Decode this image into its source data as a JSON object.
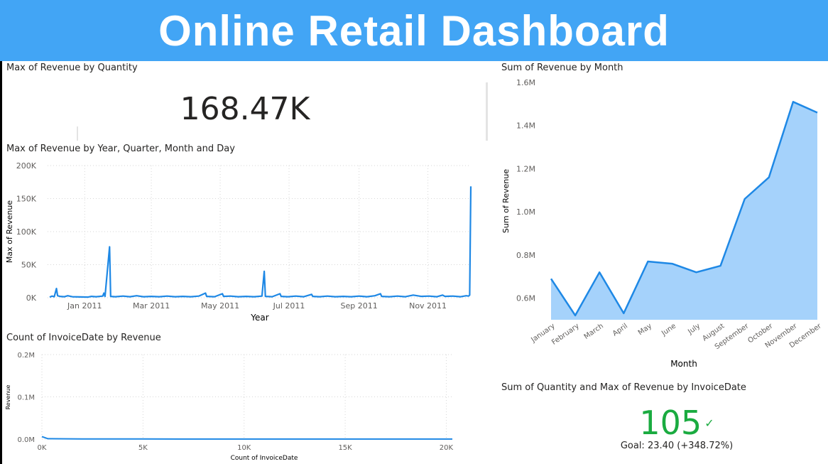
{
  "header": {
    "title": "Online Retail Dashboard"
  },
  "card": {
    "title": "Max of Revenue by Quantity",
    "value": "168.47K"
  },
  "kpi": {
    "title": "Sum of Quantity and Max of Revenue by InvoiceDate",
    "value": "105",
    "goal": "Goal: 23.40 (+348.72%)"
  },
  "chart_data": [
    {
      "type": "line",
      "title": "Max of Revenue by Year, Quarter, Month and Day",
      "xlabel": "Year",
      "ylabel": "Max of Revenue",
      "y_ticks": [
        "0K",
        "50K",
        "100K",
        "150K",
        "200K"
      ],
      "ylim": [
        0,
        200000
      ],
      "x_ticks": [
        "Jan 2011",
        "Mar 2011",
        "May 2011",
        "Jul 2011",
        "Sep 2011",
        "Nov 2011"
      ],
      "x_tick_dates": [
        "2011-01-01",
        "2011-03-01",
        "2011-05-01",
        "2011-07-01",
        "2011-09-01",
        "2011-11-01"
      ],
      "x_range": [
        "2010-12-01",
        "2011-12-09"
      ],
      "series": [
        {
          "points": [
            [
              "2010-12-01",
              1000
            ],
            [
              "2010-12-03",
              2500
            ],
            [
              "2010-12-05",
              1500
            ],
            [
              "2010-12-07",
              14000
            ],
            [
              "2010-12-08",
              3000
            ],
            [
              "2010-12-10",
              2000
            ],
            [
              "2010-12-14",
              1500
            ],
            [
              "2010-12-17",
              3000
            ],
            [
              "2010-12-21",
              1500
            ],
            [
              "2011-01-04",
              1000
            ],
            [
              "2011-01-07",
              2000
            ],
            [
              "2011-01-11",
              1500
            ],
            [
              "2011-01-17",
              2500
            ],
            [
              "2011-01-18",
              7000
            ],
            [
              "2011-01-19",
              2000
            ],
            [
              "2011-01-23",
              77000
            ],
            [
              "2011-01-24",
              2000
            ],
            [
              "2011-01-28",
              1500
            ],
            [
              "2011-02-04",
              2500
            ],
            [
              "2011-02-10",
              1500
            ],
            [
              "2011-02-16",
              3000
            ],
            [
              "2011-02-22",
              1500
            ],
            [
              "2011-03-01",
              2000
            ],
            [
              "2011-03-08",
              1500
            ],
            [
              "2011-03-15",
              2500
            ],
            [
              "2011-03-22",
              1500
            ],
            [
              "2011-03-29",
              2000
            ],
            [
              "2011-04-05",
              1500
            ],
            [
              "2011-04-12",
              2500
            ],
            [
              "2011-04-18",
              7000
            ],
            [
              "2011-04-19",
              2000
            ],
            [
              "2011-04-26",
              1500
            ],
            [
              "2011-05-03",
              6000
            ],
            [
              "2011-05-04",
              2000
            ],
            [
              "2011-05-10",
              2500
            ],
            [
              "2011-05-17",
              1500
            ],
            [
              "2011-05-24",
              2000
            ],
            [
              "2011-05-31",
              1500
            ],
            [
              "2011-06-07",
              2500
            ],
            [
              "2011-06-09",
              40000
            ],
            [
              "2011-06-10",
              2000
            ],
            [
              "2011-06-16",
              1500
            ],
            [
              "2011-06-23",
              6000
            ],
            [
              "2011-06-24",
              2000
            ],
            [
              "2011-06-30",
              1500
            ],
            [
              "2011-07-07",
              2500
            ],
            [
              "2011-07-14",
              1500
            ],
            [
              "2011-07-21",
              5000
            ],
            [
              "2011-07-22",
              2000
            ],
            [
              "2011-07-28",
              1500
            ],
            [
              "2011-08-04",
              2500
            ],
            [
              "2011-08-11",
              1500
            ],
            [
              "2011-08-18",
              2000
            ],
            [
              "2011-08-25",
              1500
            ],
            [
              "2011-09-01",
              2500
            ],
            [
              "2011-09-08",
              1500
            ],
            [
              "2011-09-15",
              3000
            ],
            [
              "2011-09-20",
              6000
            ],
            [
              "2011-09-21",
              2000
            ],
            [
              "2011-09-28",
              1500
            ],
            [
              "2011-10-05",
              2500
            ],
            [
              "2011-10-12",
              1500
            ],
            [
              "2011-10-19",
              4000
            ],
            [
              "2011-10-26",
              2000
            ],
            [
              "2011-11-02",
              2500
            ],
            [
              "2011-11-09",
              1500
            ],
            [
              "2011-11-14",
              4000
            ],
            [
              "2011-11-16",
              2000
            ],
            [
              "2011-11-23",
              2500
            ],
            [
              "2011-11-30",
              1500
            ],
            [
              "2011-12-05",
              3000
            ],
            [
              "2011-12-07",
              2500
            ],
            [
              "2011-12-08",
              4000
            ],
            [
              "2011-12-09",
              168470
            ]
          ]
        }
      ]
    },
    {
      "type": "area",
      "title": "Sum of Revenue by Month",
      "xlabel": "Month",
      "ylabel": "Sum of Revenue",
      "y_ticks": [
        "0.6M",
        "0.8M",
        "1.0M",
        "1.2M",
        "1.4M",
        "1.6M"
      ],
      "y_tick_values": [
        0.6,
        0.8,
        1.0,
        1.2,
        1.4,
        1.6
      ],
      "ylim": [
        0.5,
        1.6
      ],
      "categories": [
        "January",
        "February",
        "March",
        "April",
        "May",
        "June",
        "July",
        "August",
        "September",
        "October",
        "November",
        "December"
      ],
      "values": [
        0.69,
        0.52,
        0.72,
        0.53,
        0.77,
        0.76,
        0.72,
        0.75,
        1.06,
        1.16,
        1.51,
        1.46
      ]
    },
    {
      "type": "line",
      "title": "Count of InvoiceDate by Revenue",
      "xlabel": "Count of InvoiceDate",
      "ylabel": "Revenue",
      "y_ticks": [
        "0.0M",
        "0.1M",
        "0.2M"
      ],
      "y_tick_values": [
        0,
        0.1,
        0.2
      ],
      "ylim": [
        0,
        0.2
      ],
      "x_ticks": [
        "0K",
        "5K",
        "10K",
        "15K",
        "20K"
      ],
      "x_tick_values": [
        0,
        5,
        10,
        15,
        20
      ],
      "xlim": [
        0,
        20.3
      ],
      "series": [
        {
          "points": [
            [
              0,
              0.006
            ],
            [
              0.3,
              0.001
            ],
            [
              2,
              0.0005
            ],
            [
              5,
              0.0003
            ],
            [
              10,
              0.0002
            ],
            [
              15,
              0.0002
            ],
            [
              20.3,
              0.0001
            ]
          ]
        }
      ]
    }
  ],
  "colors": {
    "header": "#42a5f5",
    "line": "#1e88e5",
    "area_fill": "#a5d2fb",
    "kpi_good": "#1aab40"
  }
}
